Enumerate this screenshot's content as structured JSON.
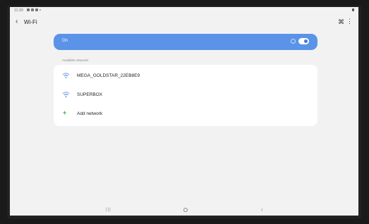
{
  "status_bar": {
    "time": "11:30"
  },
  "header": {
    "back_icon": "chevron-left-icon",
    "title": "Wi-Fi",
    "wifi_direct_icon": "wifi-direct-icon",
    "more_icon": "more-vert-icon"
  },
  "wifi_toggle": {
    "label": "On",
    "state": true,
    "accent_color": "#5b93e8"
  },
  "available": {
    "section_label": "Available networks",
    "networks": [
      {
        "name": "MEGA_GOLDSTAR_22EB8E9",
        "icon": "wifi-icon"
      },
      {
        "name": "SUPERBOX",
        "icon": "wifi-icon"
      }
    ],
    "add_network": {
      "label": "Add network",
      "icon": "plus-icon"
    }
  },
  "nav": {
    "recent_icon": "recent-apps-icon",
    "home_icon": "home-icon",
    "back_icon": "back-icon"
  }
}
